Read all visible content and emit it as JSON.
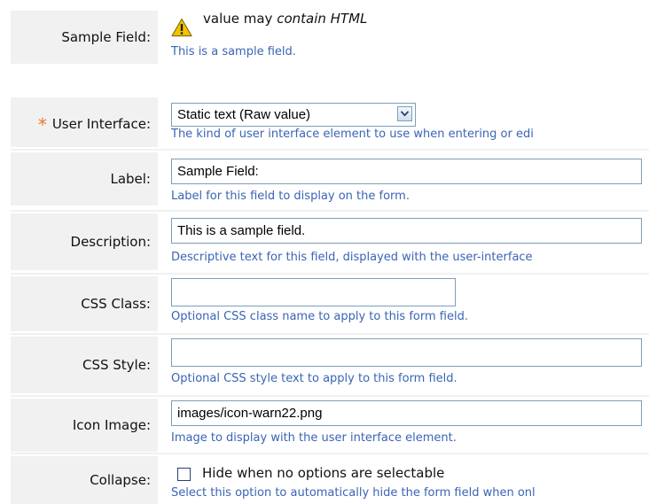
{
  "sample": {
    "label": "Sample Field:",
    "value_prefix": "value may",
    "value_italic": "contain HTML",
    "description": "This is a sample field.",
    "icon": "warning-triangle-icon"
  },
  "fields": {
    "user_interface": {
      "required_mark": "*",
      "label": "User Interface:",
      "selected": "Static text (Raw value)",
      "description": "The kind of user interface element to use when entering or edi"
    },
    "label": {
      "label": "Label:",
      "value": "Sample Field:",
      "description": "Label for this field to display on the form."
    },
    "description": {
      "label": "Description:",
      "value": "This is a sample field.",
      "description": "Descriptive text for this field, displayed with the user-interface"
    },
    "css_class": {
      "label": "CSS Class:",
      "value": "",
      "description": "Optional CSS class name to apply to this form field."
    },
    "css_style": {
      "label": "CSS Style:",
      "value": "",
      "description": "Optional CSS style text to apply to this form field."
    },
    "icon_image": {
      "label": "Icon Image:",
      "value": "images/icon-warn22.png",
      "description": "Image to display with the user interface element."
    },
    "collapse": {
      "label": "Collapse:",
      "checkbox_label": "Hide when no options are selectable",
      "checked": false,
      "description": "Select this option to automatically hide the form field when onl"
    }
  },
  "colors": {
    "label_bg": "#f1f1f1",
    "description_text": "#3a64b5",
    "required_star": "#e87a2a",
    "input_border": "#7f9db9",
    "warning_fill": "#f5c400"
  }
}
